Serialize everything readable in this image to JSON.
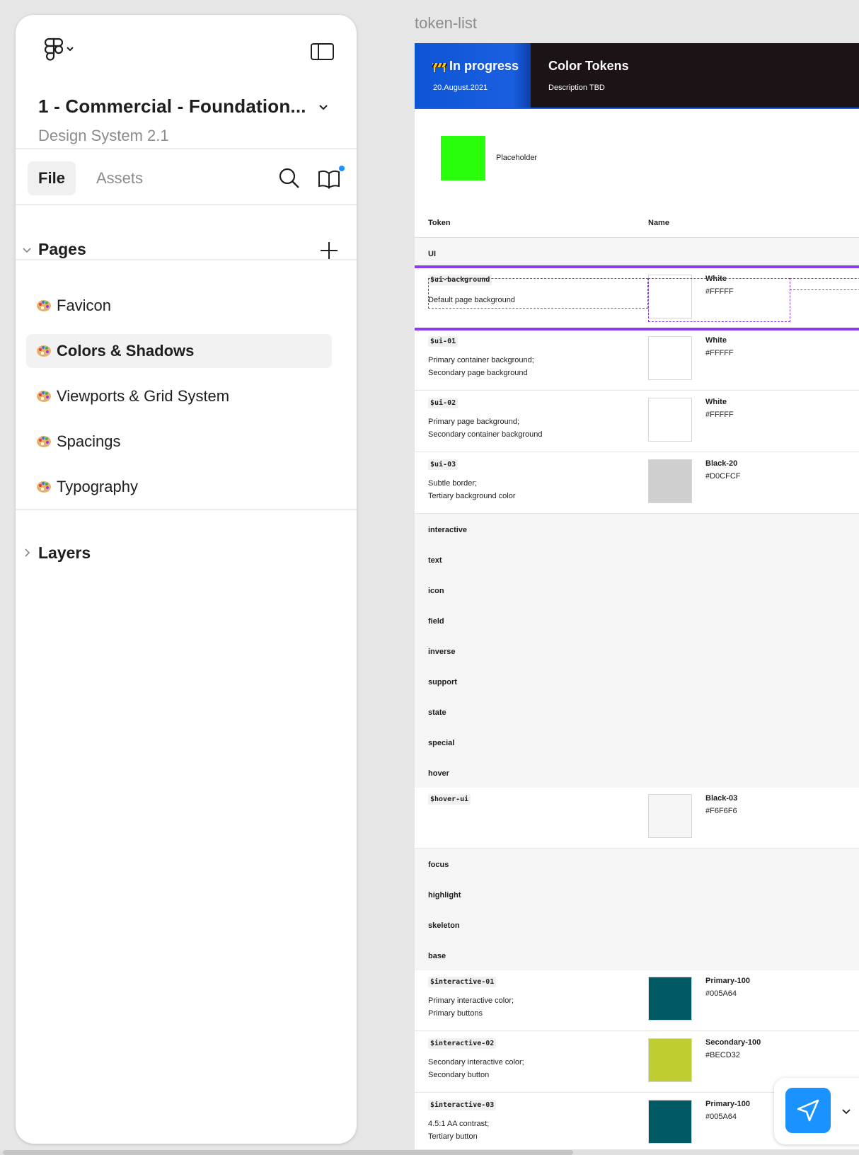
{
  "sidebar": {
    "file_title": "1 - Commercial - Foundation...",
    "file_subtitle": "Design System 2.1",
    "tabs": {
      "file": "File",
      "assets": "Assets"
    },
    "pages_heading": "Pages",
    "pages": [
      {
        "label": "Favicon",
        "active": false
      },
      {
        "label": "Colors & Shadows",
        "active": true
      },
      {
        "label": "Viewports & Grid System",
        "active": false
      },
      {
        "label": "Spacings",
        "active": false
      },
      {
        "label": "Typography",
        "active": false
      }
    ],
    "layers_heading": "Layers",
    "notification_color": "#1a92ff"
  },
  "canvas": {
    "frame_label": "token-list",
    "status": {
      "label": "In progress",
      "date": "20.August.2021",
      "color": "#0d55d6"
    },
    "header": {
      "title": "Color Tokens",
      "description": "Description TBD"
    },
    "placeholder": {
      "label": "Placeholder",
      "color": "#29FF0A"
    },
    "columns": {
      "token": "Token",
      "name": "Name"
    },
    "groups": [
      "UI",
      "interactive",
      "text",
      "icon",
      "field",
      "inverse",
      "support",
      "state",
      "special",
      "hover",
      "focus",
      "highlight",
      "skeleton",
      "base"
    ],
    "tokens": [
      {
        "code": "$ui-background",
        "desc": [
          "Default page background"
        ],
        "name": "White",
        "hex": "#FFFFF",
        "swatch": "#FFFFFF",
        "selected": true
      },
      {
        "code": "$ui-01",
        "desc": [
          "Primary container background;",
          "Secondary page background"
        ],
        "name": "White",
        "hex": "#FFFFF",
        "swatch": "#FFFFFF"
      },
      {
        "code": "$ui-02",
        "desc": [
          "Primary page background;",
          "Secondary container background"
        ],
        "name": "White",
        "hex": "#FFFFF",
        "swatch": "#FFFFFF"
      },
      {
        "code": "$ui-03",
        "desc": [
          "Subtle border;",
          "Tertiary background color"
        ],
        "name": "Black-20",
        "hex": "#D0CFCF",
        "swatch": "#D0CFCF"
      },
      {
        "code": "$hover-ui",
        "desc": [],
        "name": "Black-03",
        "hex": "#F6F6F6",
        "swatch": "#F6F6F6"
      },
      {
        "code": "$interactive-01",
        "desc": [
          "Primary interactive color;",
          "Primary buttons"
        ],
        "name": "Primary-100",
        "hex": "#005A64",
        "swatch": "#005A64"
      },
      {
        "code": "$interactive-02",
        "desc": [
          "Secondary interactive color;",
          "Secondary button"
        ],
        "name": "Secondary-100",
        "hex": "#BECD32",
        "swatch": "#BECD32"
      },
      {
        "code": "$interactive-03",
        "desc": [
          "4.5:1 AA contrast;",
          "Tertiary button"
        ],
        "name": "Primary-100",
        "hex": "#005A64",
        "swatch": "#005A64"
      }
    ],
    "selection_color": "#8a3cf0"
  }
}
